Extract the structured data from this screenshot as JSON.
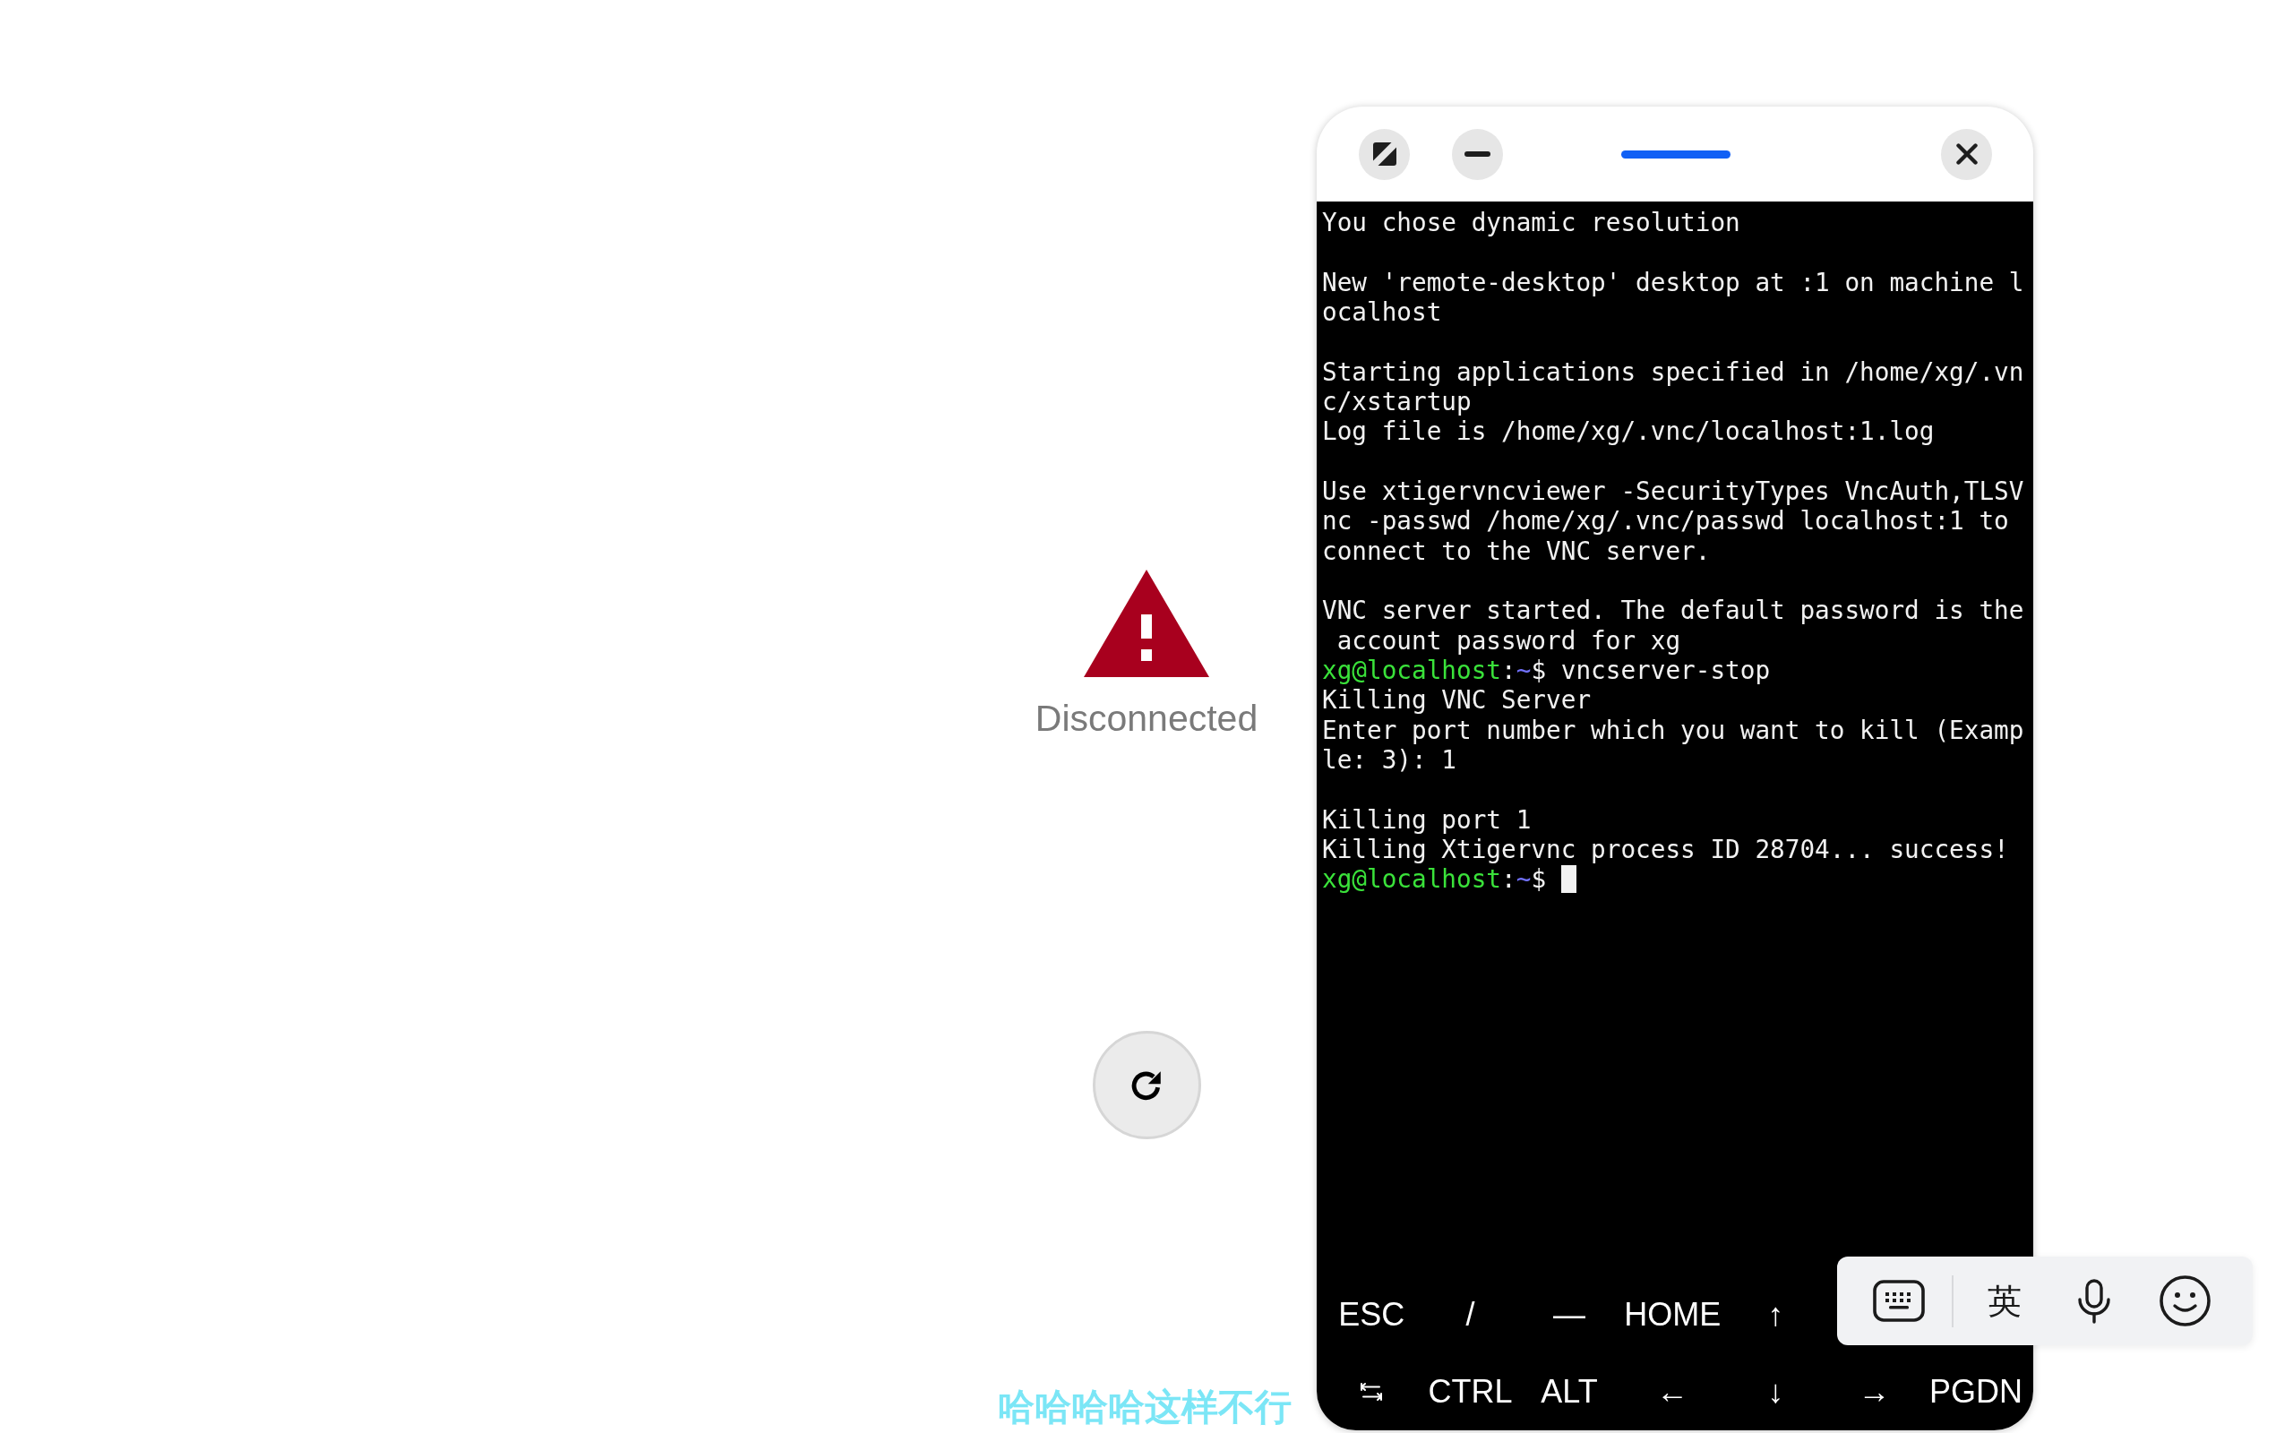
{
  "viewer": {
    "status": "Disconnected"
  },
  "terminal_window": {
    "terminal": {
      "lines": [
        {
          "kind": "output",
          "text": "You chose dynamic resolution"
        },
        {
          "kind": "blank"
        },
        {
          "kind": "output",
          "text": "New 'remote-desktop' desktop at :1 on machine l"
        },
        {
          "kind": "output",
          "text": "ocalhost"
        },
        {
          "kind": "blank"
        },
        {
          "kind": "output",
          "text": "Starting applications specified in /home/xg/.vn"
        },
        {
          "kind": "output",
          "text": "c/xstartup"
        },
        {
          "kind": "output",
          "text": "Log file is /home/xg/.vnc/localhost:1.log"
        },
        {
          "kind": "blank"
        },
        {
          "kind": "output",
          "text": "Use xtigervncviewer -SecurityTypes VncAuth,TLSV"
        },
        {
          "kind": "output",
          "text": "nc -passwd /home/xg/.vnc/passwd localhost:1 to"
        },
        {
          "kind": "output",
          "text": "connect to the VNC server."
        },
        {
          "kind": "blank"
        },
        {
          "kind": "output",
          "text": "VNC server started. The default password is the"
        },
        {
          "kind": "output",
          "text": " account password for xg"
        },
        {
          "kind": "prompt",
          "user_host": "xg@localhost",
          "separator": ":",
          "path": "~",
          "symbol": "$",
          "command": "vncserver-stop",
          "cursor": false
        },
        {
          "kind": "output",
          "text": "Killing VNC Server"
        },
        {
          "kind": "output",
          "text": "Enter port number which you want to kill (Examp"
        },
        {
          "kind": "output",
          "text": "le: 3): 1"
        },
        {
          "kind": "blank"
        },
        {
          "kind": "output",
          "text": "Killing port 1"
        },
        {
          "kind": "output",
          "text": "Killing Xtigervnc process ID 28704... success!"
        },
        {
          "kind": "prompt",
          "user_host": "xg@localhost",
          "separator": ":",
          "path": "~",
          "symbol": "$",
          "cursor": true
        }
      ]
    },
    "extra_keys": {
      "rows": [
        [
          {
            "kind": "text",
            "label": "ESC"
          },
          {
            "kind": "text",
            "label": "/"
          },
          {
            "kind": "text",
            "label": "—"
          },
          {
            "kind": "text",
            "label": "HOME"
          },
          {
            "kind": "text",
            "label": "↑"
          }
        ],
        [
          {
            "kind": "tab"
          },
          {
            "kind": "text",
            "label": "CTRL"
          },
          {
            "kind": "text",
            "label": "ALT"
          },
          {
            "kind": "text",
            "label": "←"
          },
          {
            "kind": "text",
            "label": "↓"
          },
          {
            "kind": "text",
            "label": "→"
          },
          {
            "kind": "text",
            "label": "PGDN"
          }
        ]
      ]
    }
  },
  "input_method_bar": {
    "language_key": "英"
  },
  "caption": "哈哈哈哈这样不行"
}
